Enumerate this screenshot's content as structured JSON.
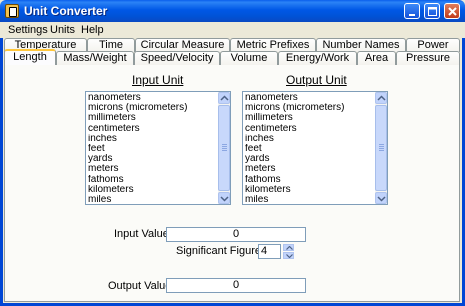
{
  "window": {
    "title": "Unit Converter",
    "title_bar_color": "#0058E6"
  },
  "menu": {
    "items": [
      "Settings",
      "Units",
      "Help"
    ]
  },
  "tabs": {
    "row_back": [
      "Temperature",
      "Time",
      "Circular Measure",
      "Metric Prefixes",
      "Number Names",
      "Power"
    ],
    "row_front": [
      "Length",
      "Mass/Weight",
      "Speed/Velocity",
      "Volume",
      "Energy/Work",
      "Area",
      "Pressure"
    ],
    "active": "Length"
  },
  "input_unit": {
    "header": "Input Unit",
    "items": [
      "nanometers",
      "microns (micrometers)",
      "millimeters",
      "centimeters",
      "inches",
      "feet",
      "yards",
      "meters",
      "fathoms",
      "kilometers",
      "miles"
    ]
  },
  "output_unit": {
    "header": "Output Unit",
    "items": [
      "nanometers",
      "microns (micrometers)",
      "millimeters",
      "centimeters",
      "inches",
      "feet",
      "yards",
      "meters",
      "fathoms",
      "kilometers",
      "miles"
    ]
  },
  "form": {
    "input_value_label": "Input Value:",
    "input_value": "0",
    "sig_figs_label": "Significant Figures:",
    "sig_figs_value": "4",
    "output_value_label": "Output Value:",
    "output_value": "0"
  },
  "icons": {
    "app": "ruler-icon",
    "minimize": "minimize-icon",
    "maximize": "maximize-icon",
    "close": "close-icon"
  }
}
